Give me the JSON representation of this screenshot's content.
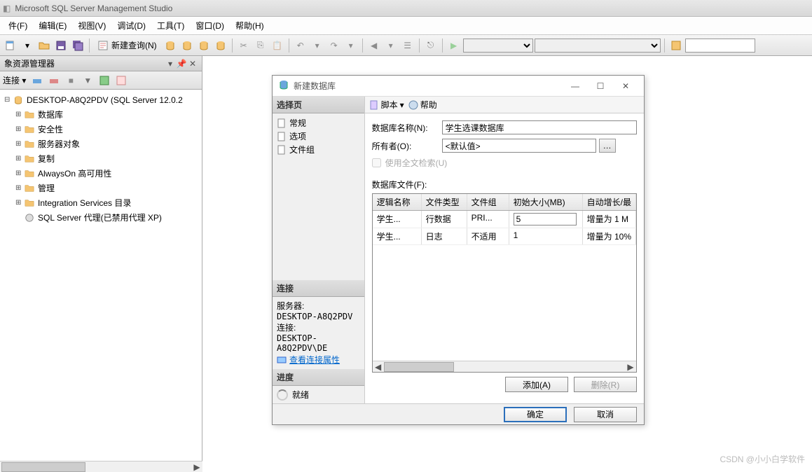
{
  "app": {
    "title": "Microsoft SQL Server Management Studio"
  },
  "menu": {
    "file": "件(F)",
    "edit": "编辑(E)",
    "view": "视图(V)",
    "debug": "调试(D)",
    "tools": "工具(T)",
    "window": "窗口(D)",
    "help": "帮助(H)"
  },
  "toolbar": {
    "new_query": "新建查询(N)"
  },
  "explorer": {
    "title": "象资源管理器",
    "connect": "连接 ▾",
    "root": "DESKTOP-A8Q2PDV (SQL Server 12.0.2",
    "nodes": {
      "db": "数据库",
      "sec": "安全性",
      "srvobj": "服务器对象",
      "repl": "复制",
      "alwayson": "AlwaysOn 高可用性",
      "mgmt": "管理",
      "isc": "Integration Services 目录",
      "agent": "SQL Server 代理(已禁用代理 XP)"
    }
  },
  "dialog": {
    "title": "新建数据库",
    "left": {
      "select_page": "选择页",
      "general": "常规",
      "options": "选项",
      "filegroups": "文件组",
      "connection": "连接",
      "server_lbl": "服务器:",
      "server_val": "DESKTOP-A8Q2PDV",
      "conn_lbl": "连接:",
      "conn_val": "DESKTOP-A8Q2PDV\\DE",
      "view_props": "查看连接属性",
      "progress": "进度",
      "ready": "就绪"
    },
    "right": {
      "script": "脚本",
      "help": "帮助",
      "dbname_lbl": "数据库名称(N):",
      "dbname_val": "学生选课数据库",
      "owner_lbl": "所有者(O):",
      "owner_val": "<默认值>",
      "fulltext": "使用全文检索(U)",
      "files_lbl": "数据库文件(F):",
      "cols": {
        "name": "逻辑名称",
        "type": "文件类型",
        "group": "文件组",
        "size": "初始大小(MB)",
        "grow": "自动增长/最"
      },
      "rows": [
        {
          "name": "学生...",
          "type": "行数据",
          "group": "PRI...",
          "size": "5",
          "grow": "增量为 1 M"
        },
        {
          "name": "学生...",
          "type": "日志",
          "group": "不适用",
          "size": "1",
          "grow": "增量为 10%"
        }
      ],
      "add": "添加(A)",
      "delete": "删除(R)",
      "ok": "确定",
      "cancel": "取消"
    }
  },
  "watermark": "CSDN @小小白学软件"
}
